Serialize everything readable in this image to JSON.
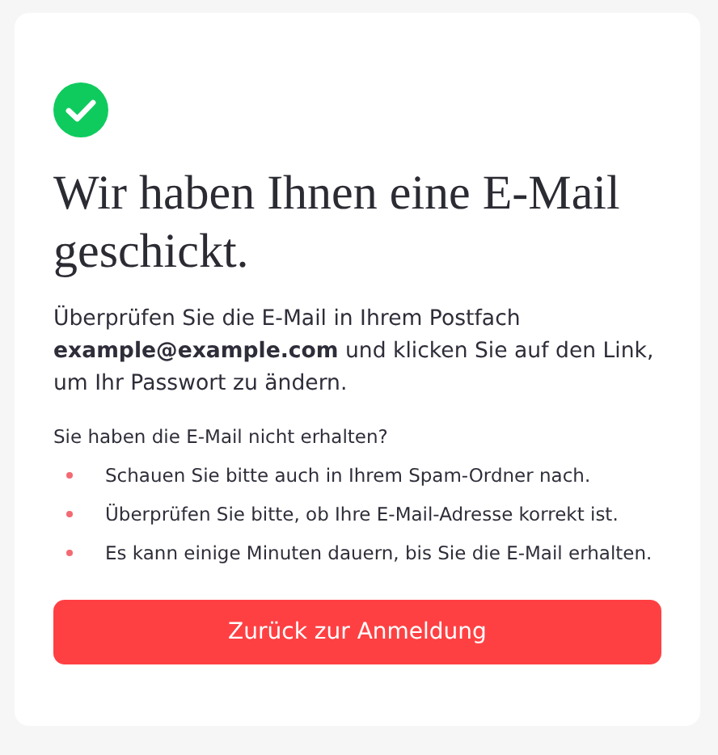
{
  "sent": true,
  "heading": "Wir haben Ihnen eine E-Mail geschickt.",
  "message": "Überprüfen Sie die E-Mail in Ihrem Postfach **example@example.com** und klicken Sie auf den Link, um Ihr Passwort zu ändern.",
  "help_title": "Sie haben die E-Mail nicht erhalten?",
  "help_items": [
    "Schauen Sie bitte auch in Ihrem Spam-Ordner nach.",
    "Überprüfen Sie bitte, ob Ihre E-Mail-Adresse korrekt ist.",
    "Es kann einige Minuten dauern, bis Sie die E-Mail erhalten."
  ],
  "button": "Zurück zur Anmeldung"
}
